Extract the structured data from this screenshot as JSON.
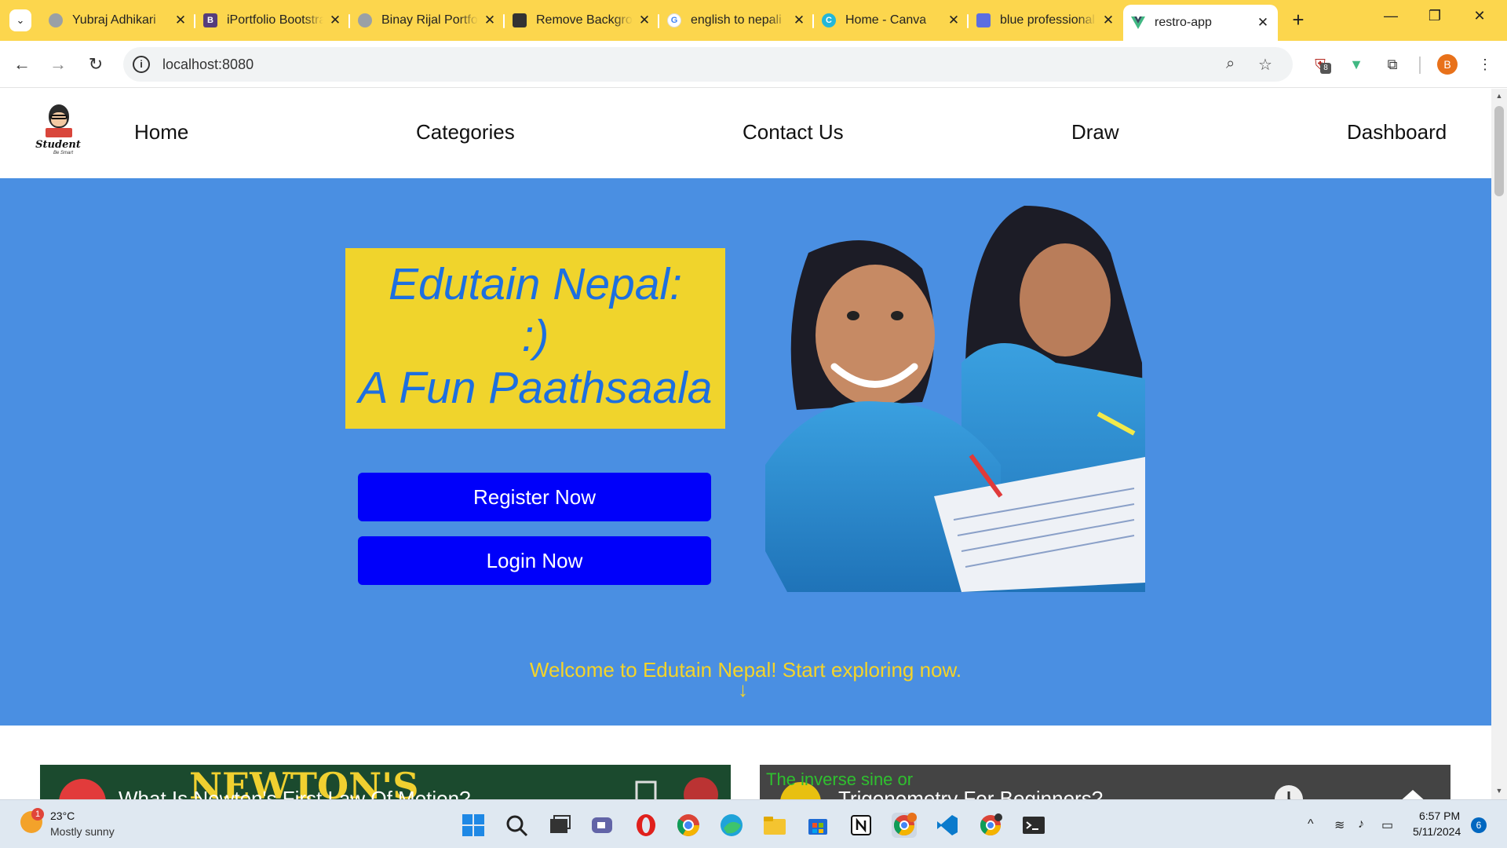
{
  "browser": {
    "tabs": [
      {
        "title": "Yubraj Adhikari",
        "favicon": "globe-icon",
        "active": false
      },
      {
        "title": "iPortfolio Bootstrap",
        "favicon": "bootstrap-icon",
        "active": false
      },
      {
        "title": "Binay Rijal Portfolio",
        "favicon": "globe-icon",
        "active": false
      },
      {
        "title": "Remove Background",
        "favicon": "remove-bg-icon",
        "active": false
      },
      {
        "title": "english to nepali",
        "favicon": "google-icon",
        "active": false
      },
      {
        "title": "Home - Canva",
        "favicon": "canva-icon",
        "active": false
      },
      {
        "title": "blue professional",
        "favicon": "doc-icon",
        "active": false
      },
      {
        "title": "restro-app",
        "favicon": "vue-icon",
        "active": true
      }
    ],
    "new_tab_symbol": "+",
    "close_symbol": "✕",
    "address": "localhost:8080",
    "extension_badge": "8",
    "profile_initial": "B",
    "colors": {
      "tabstrip": "#fcd64d",
      "active_tab": "#ffffff",
      "profile": "#e8711a"
    }
  },
  "site": {
    "logo_word": "Student",
    "logo_tag": "Be Smart",
    "nav": [
      "Home",
      "Categories",
      "Contact Us",
      "Draw",
      "Dashboard"
    ],
    "hero": {
      "title_lines": [
        "Edutain Nepal:",
        ":)",
        "A Fun Paathsaala"
      ],
      "register_label": "Register Now",
      "login_label": "Login Now",
      "welcome": "Welcome to Edutain Nepal! Start exploring now.",
      "arrow": "↓"
    },
    "videos": [
      {
        "title_partial": "What Is Newton's First Law Of Motion?",
        "overlay": "NEWTON'S"
      },
      {
        "title_partial": "Trigonometry For Beginners?",
        "overlay": "The inverse sine or"
      }
    ],
    "colors": {
      "hero_bg": "#4a8fe2",
      "title_box": "#f0d42c",
      "title_text": "#1d6fe0",
      "button": "#0000fa",
      "welcome_text": "#f5d428"
    }
  },
  "taskbar": {
    "weather_temp": "23°C",
    "weather_desc": "Mostly sunny",
    "weather_badge": "1",
    "time": "6:57 PM",
    "date": "5/11/2024",
    "notifications": "6"
  }
}
